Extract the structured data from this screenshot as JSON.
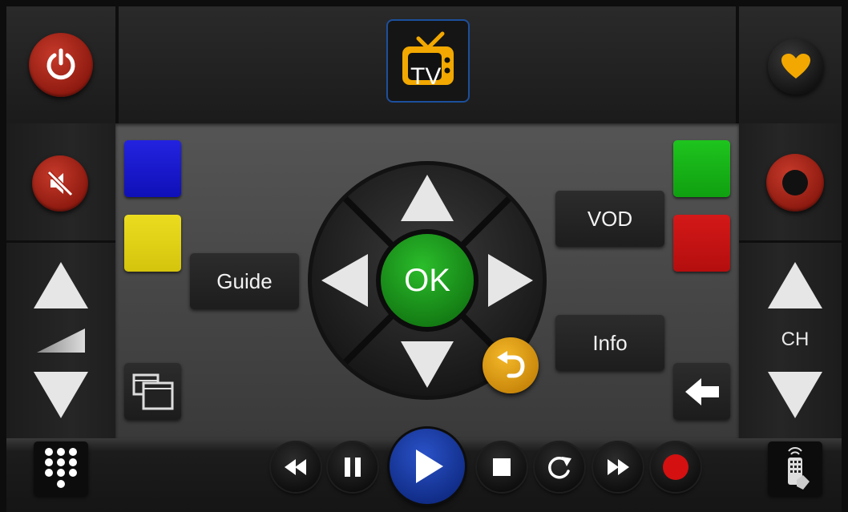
{
  "header": {
    "logo_text": "TV",
    "power_icon": "power-icon",
    "favorite_icon": "heart-icon"
  },
  "left_panel": {
    "mute_icon": "mute-icon",
    "volume_up_icon": "triangle-up-icon",
    "volume_level_icon": "volume-ramp-icon",
    "volume_down_icon": "triangle-down-icon"
  },
  "right_panel": {
    "record_icon": "record-ring-icon",
    "channel_label": "CH",
    "channel_up_icon": "triangle-up-icon",
    "channel_down_icon": "triangle-down-icon"
  },
  "color_keys": {
    "blue": "#1a1ad0",
    "yellow": "#e0d012",
    "green": "#14b014",
    "red": "#c01414"
  },
  "buttons": {
    "guide": "Guide",
    "vod": "VOD",
    "info": "Info",
    "ok": "OK",
    "back_icon": "undo-arrow-icon",
    "exit_icon": "left-arrow-icon",
    "pip_icon": "overlapping-windows-icon"
  },
  "colors": {
    "ok_green": "#1e9a1e",
    "back_orange": "#e8a010",
    "play_blue": "#1c3ea8",
    "record_red": "#d41010",
    "power_red": "#a82214"
  },
  "media_bar": {
    "keypad_icon": "keypad-icon",
    "remote_icon": "remote-control-icon",
    "controls": [
      "rewind-icon",
      "pause-icon",
      "play-icon",
      "stop-icon",
      "replay-icon",
      "fast-forward-icon",
      "record-icon"
    ]
  }
}
